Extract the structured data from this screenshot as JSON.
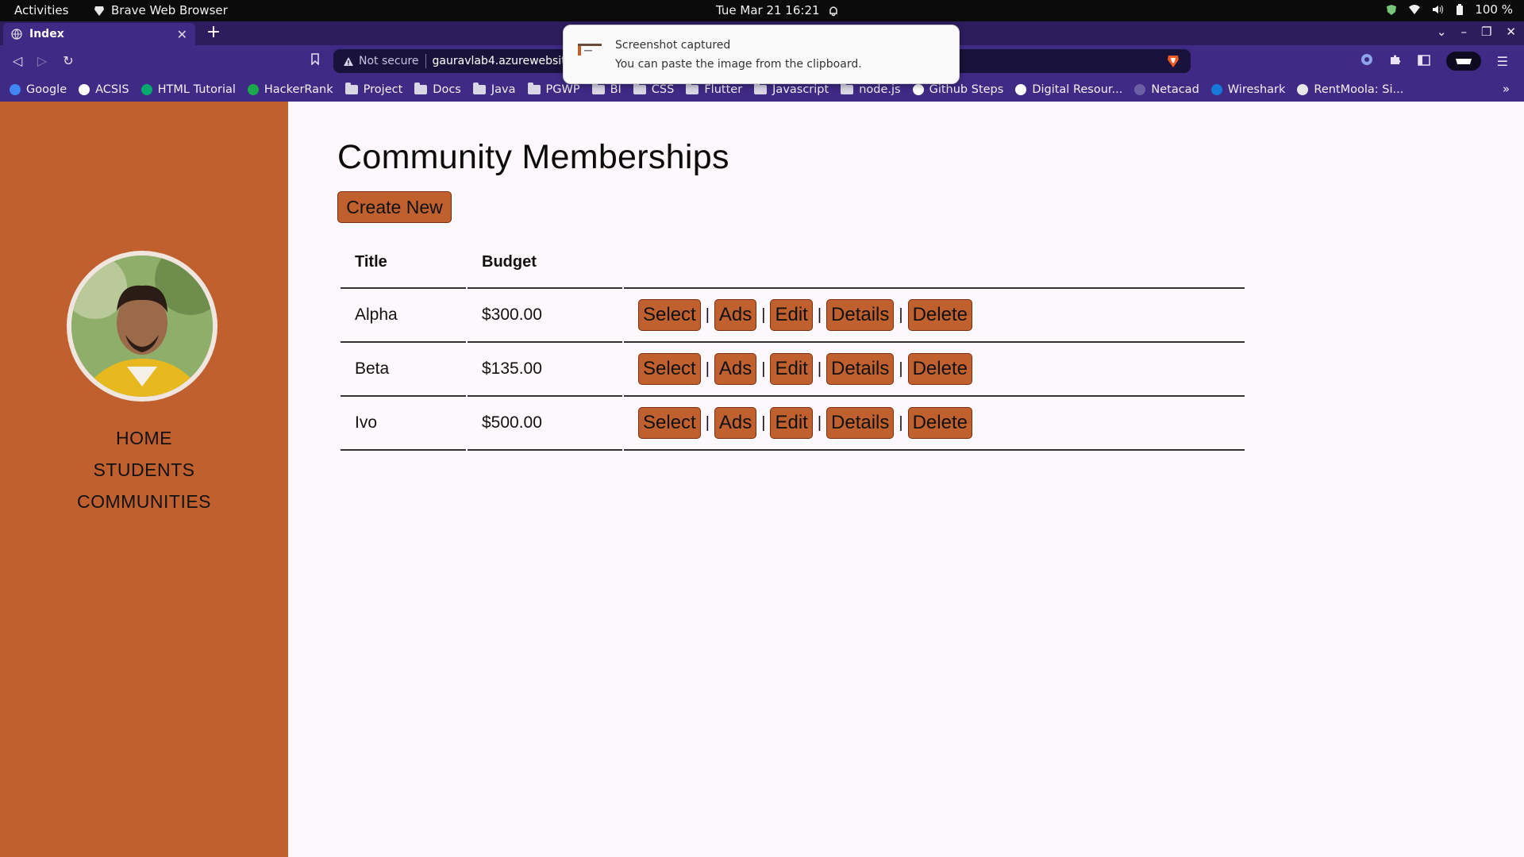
{
  "system_bar": {
    "activities": "Activities",
    "app_name": "Brave Web Browser",
    "datetime": "Tue Mar 21  16:21",
    "battery": "100 %"
  },
  "browser": {
    "tab_title": "Index",
    "address": {
      "security_label": "Not secure",
      "url": "gauravlab4.azurewebsites.net"
    },
    "bookmarks": [
      {
        "label": "Google",
        "icon": "google-icon"
      },
      {
        "label": "ACSIS",
        "icon": "acsis-icon"
      },
      {
        "label": "HTML Tutorial",
        "icon": "w3-icon"
      },
      {
        "label": "HackerRank",
        "icon": "hackerrank-icon"
      },
      {
        "label": "Project",
        "icon": "folder-icon"
      },
      {
        "label": "Docs",
        "icon": "folder-icon"
      },
      {
        "label": "Java",
        "icon": "folder-icon"
      },
      {
        "label": "PGWP",
        "icon": "folder-icon"
      },
      {
        "label": "BI",
        "icon": "folder-icon"
      },
      {
        "label": "CSS",
        "icon": "folder-icon"
      },
      {
        "label": "Flutter",
        "icon": "folder-icon"
      },
      {
        "label": "Javascript",
        "icon": "folder-icon"
      },
      {
        "label": "node.js",
        "icon": "folder-icon"
      },
      {
        "label": "Github Steps",
        "icon": "github-icon"
      },
      {
        "label": "Digital Resour...",
        "icon": "digital-resources-icon"
      },
      {
        "label": "Netacad",
        "icon": "netacad-icon"
      },
      {
        "label": "Wireshark",
        "icon": "wireshark-icon"
      },
      {
        "label": "RentMoola: Si...",
        "icon": "rentmoola-icon"
      }
    ]
  },
  "notification": {
    "title": "Screenshot captured",
    "body": "You can paste the image from the clipboard."
  },
  "sidebar": {
    "nav": [
      {
        "label": "HOME"
      },
      {
        "label": "STUDENTS"
      },
      {
        "label": "COMMUNITIES"
      }
    ]
  },
  "main": {
    "title": "Community Memberships",
    "create_label": "Create New",
    "table": {
      "headers": {
        "title": "Title",
        "budget": "Budget"
      },
      "rows": [
        {
          "title": "Alpha",
          "budget": "$300.00"
        },
        {
          "title": "Beta",
          "budget": "$135.00"
        },
        {
          "title": "Ivo",
          "budget": "$500.00"
        }
      ],
      "actions": {
        "select": "Select",
        "ads": "Ads",
        "edit": "Edit",
        "details": "Details",
        "delete": "Delete",
        "separator": "|"
      }
    }
  },
  "colors": {
    "accent": "#c0602f",
    "browser_chrome": "#3f2a86",
    "page_bg": "#fdf8fb"
  }
}
